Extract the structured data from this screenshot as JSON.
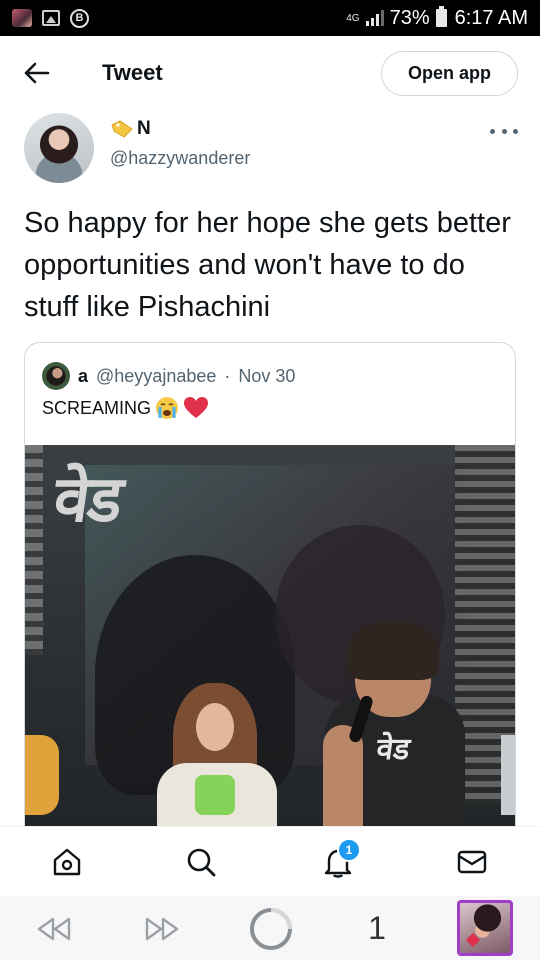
{
  "status_bar": {
    "network": "4G",
    "battery": "73%",
    "time": "6:17 AM",
    "b_icon_letter": "B"
  },
  "header": {
    "title": "Tweet",
    "open_app_label": "Open app"
  },
  "tweet": {
    "author_name": "N",
    "author_handle": "@hazzywanderer",
    "text": "So happy for her hope she gets better opportunities and won't have to do stuff like Pishachini"
  },
  "quoted_tweet": {
    "author_name": "a",
    "author_handle": "@heyyajnabee",
    "separator": "·",
    "date": "Nov 30",
    "text": "SCREAMING",
    "emojis": [
      "crying-face",
      "red-heart"
    ]
  },
  "media": {
    "logo_text": "वेड",
    "tee_text": "वेड"
  },
  "bottom_nav": {
    "items": [
      "home",
      "search",
      "notifications",
      "messages"
    ],
    "notification_count": "1"
  },
  "browser_bar": {
    "tab_count": "1"
  },
  "colors": {
    "accent": "#1d9bf0",
    "text_primary": "#0f1419",
    "text_secondary": "#536471",
    "border": "#cfd9de",
    "heart": "#e0304b"
  }
}
